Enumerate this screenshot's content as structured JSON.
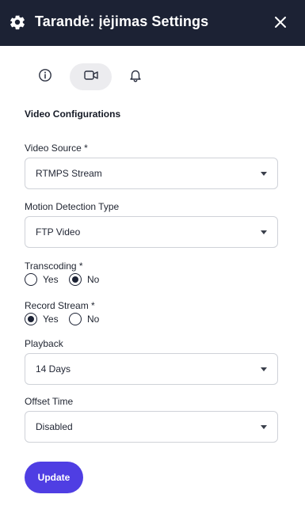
{
  "header": {
    "title": "Tarandė: įėjimas Settings",
    "settings_icon": "gear-icon",
    "close_icon": "close-icon"
  },
  "tabs": [
    {
      "name": "info",
      "icon": "info-icon",
      "active": false
    },
    {
      "name": "video",
      "icon": "video-camera-icon",
      "active": true
    },
    {
      "name": "notifications",
      "icon": "bell-icon",
      "active": false
    }
  ],
  "section_title": "Video Configurations",
  "fields": {
    "video_source": {
      "label": "Video Source *",
      "value": "RTMPS Stream"
    },
    "motion_detection": {
      "label": "Motion Detection Type",
      "value": "FTP Video"
    },
    "transcoding": {
      "label": "Transcoding *",
      "options": [
        "Yes",
        "No"
      ],
      "selected": "No"
    },
    "record_stream": {
      "label": "Record Stream *",
      "options": [
        "Yes",
        "No"
      ],
      "selected": "Yes"
    },
    "playback": {
      "label": "Playback",
      "value": "14 Days"
    },
    "offset_time": {
      "label": "Offset Time",
      "value": "Disabled"
    }
  },
  "update_label": "Update",
  "colors": {
    "header_bg": "#1c2234",
    "accent": "#4f3ee3",
    "active_tab_bg": "#ececef"
  }
}
